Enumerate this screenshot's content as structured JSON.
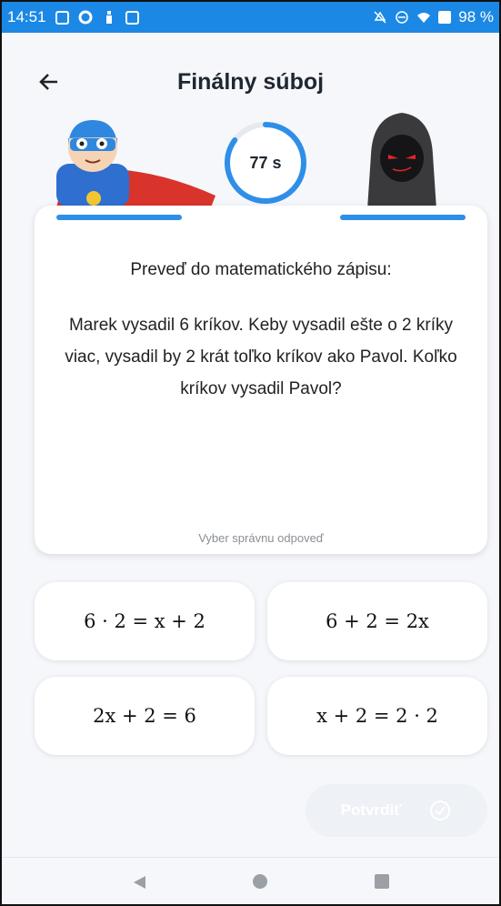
{
  "status_bar": {
    "time": "14:51",
    "battery": "98 %",
    "icons": [
      "image-icon",
      "sync-icon",
      "person-icon",
      "sim-icon",
      "mute-icon",
      "dnd-icon",
      "wifi-icon",
      "battery-icon"
    ]
  },
  "header": {
    "title": "Finálny súboj",
    "back_icon": "arrow-left-icon"
  },
  "duel": {
    "timer": "77 s",
    "timer_progress": 0.85,
    "player_avatar": "superhero-icon",
    "opponent_avatar": "hooded-villain-icon",
    "player_health": 1.0,
    "opponent_health": 1.0
  },
  "question": {
    "title": "Preveď do matematického zápisu:",
    "text": "Marek vysadil 6 kríkov. Keby vysadil ešte o 2 kríky viac, vysadil by 2 krát toľko kríkov ako Pavol. Koľko kríkov vysadil Pavol?",
    "hint": "Vyber správnu odpoveď"
  },
  "answers": [
    "6 · 2 = x + 2",
    "6 + 2 = 2x",
    "2x + 2 = 6",
    "x + 2 = 2 · 2"
  ],
  "confirm": {
    "label": "Potvrdiť",
    "icon": "check-circle-icon"
  },
  "nav_bar": {
    "icons": [
      "nav-back-icon",
      "nav-home-icon",
      "nav-recents-icon"
    ]
  },
  "colors": {
    "accent": "#1c88e5",
    "health_bar": "#2f8fe8",
    "background": "#f5f7fb",
    "confirm_disabled": "#eef1f5"
  }
}
